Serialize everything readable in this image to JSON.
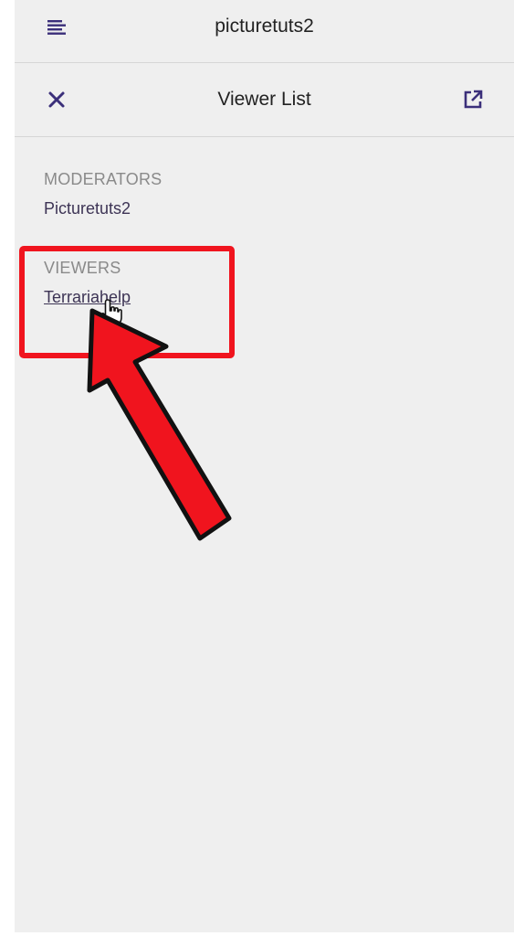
{
  "header": {
    "channel_name": "picturetuts2",
    "menu_icon": "menu-icon"
  },
  "viewer_panel": {
    "title": "Viewer List",
    "close_icon": "close-icon",
    "popout_icon": "popout-icon"
  },
  "sections": {
    "moderators": {
      "label": "MODERATORS",
      "names": [
        "Picturetuts2"
      ]
    },
    "viewers": {
      "label": "VIEWERS",
      "names": [
        "Terrariahelp"
      ]
    }
  },
  "colors": {
    "background": "#efefef",
    "accent_icon": "#3b2f7a",
    "annotation_red": "#f0141e"
  }
}
